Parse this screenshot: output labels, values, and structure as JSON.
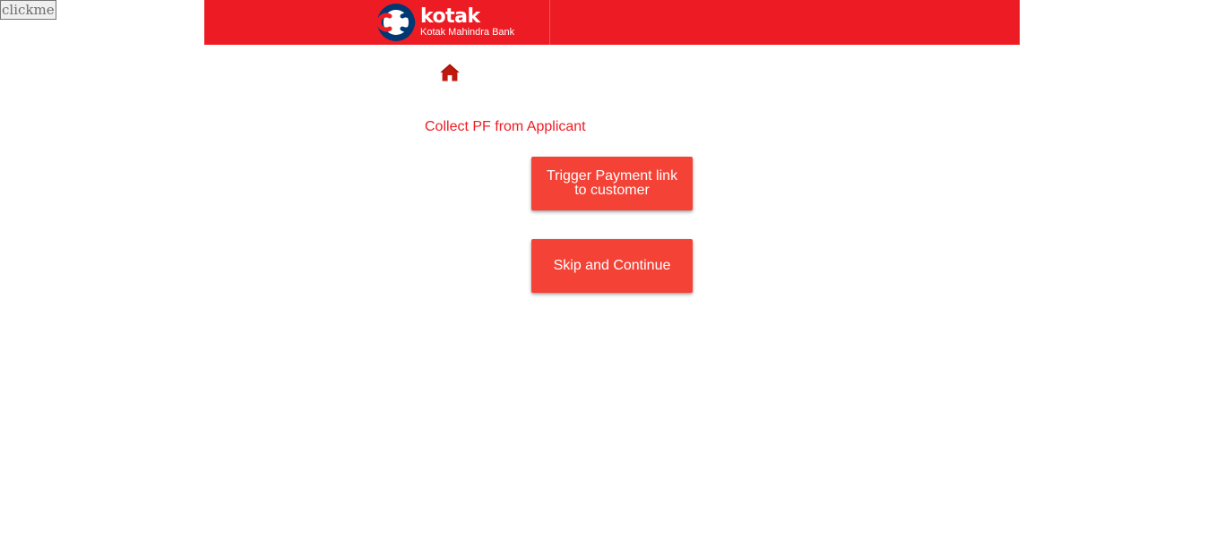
{
  "debug_button": {
    "label": "clickme"
  },
  "header": {
    "brand_name": "kotak",
    "brand_subtitle": "Kotak Mahindra Bank",
    "background_color": "#ed1c24",
    "logo_ring_color": "#003874"
  },
  "nav": {
    "home_icon": "home-icon",
    "home_icon_color": "#c0190f"
  },
  "main": {
    "title": "Collect PF from Applicant",
    "title_color": "#ed1c24",
    "buttons": [
      {
        "label": "Trigger Payment link to customer"
      },
      {
        "label": "Skip and Continue"
      }
    ],
    "button_color": "#f44336"
  }
}
